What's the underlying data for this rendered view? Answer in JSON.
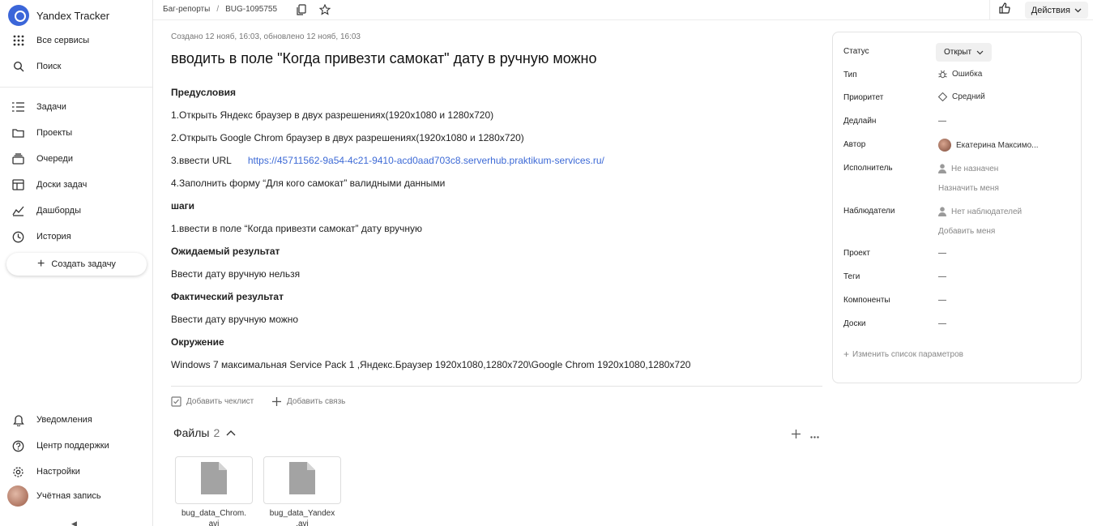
{
  "app": {
    "name": "Yandex Tracker"
  },
  "sidebar": {
    "top_items": [
      {
        "label": "Все сервисы",
        "icon": "grid-icon"
      },
      {
        "label": "Поиск",
        "icon": "search-icon"
      }
    ],
    "nav_items": [
      {
        "label": "Задачи",
        "icon": "tasks-icon"
      },
      {
        "label": "Проекты",
        "icon": "projects-icon"
      },
      {
        "label": "Очереди",
        "icon": "queues-icon"
      },
      {
        "label": "Доски задач",
        "icon": "boards-icon"
      },
      {
        "label": "Дашборды",
        "icon": "dashboards-icon"
      },
      {
        "label": "История",
        "icon": "history-icon"
      }
    ],
    "create_label": "Создать задачу",
    "bottom_items": [
      {
        "label": "Уведомления",
        "icon": "bell-icon"
      },
      {
        "label": "Центр поддержки",
        "icon": "help-icon"
      },
      {
        "label": "Настройки",
        "icon": "gear-icon"
      },
      {
        "label": "Учётная запись",
        "icon": "avatar"
      }
    ]
  },
  "topbar": {
    "breadcrumb_queue": "Баг-репорты",
    "breadcrumb_sep": "/",
    "breadcrumb_issue": "BUG-1095755",
    "actions_label": "Действия"
  },
  "issue": {
    "meta": "Создано 12 нояб, 16:03, обновлено 12 нояб, 16:03",
    "title": "вводить в поле \"Когда привезти самокат\" дату в ручную можно",
    "description": {
      "h_preconditions": "Предусловия",
      "p1": "1.Открыть Яндекс браузер в двух разрешениях(1920х1080 и 1280х720)",
      "p2": "2.Открыть Google Chrom браузер в двух разрешениях(1920х1080 и 1280х720)",
      "p3_prefix": "3.ввести URL",
      "p3_link": "https://45711562-9a54-4c21-9410-acd0aad703c8.serverhub.praktikum-services.ru/",
      "p4": "4.Заполнить форму “Для кого самокат” валидными данными",
      "h_steps": "шаги",
      "s1": "1.ввести в поле “Когда привезти самокат” дату вручную",
      "h_expected": "Ожидаемый результат",
      "expected": "Ввести дату вручную нельзя",
      "h_actual": "Фактический результат",
      "actual": "Ввести дату вручную можно",
      "h_env": "Окружение",
      "env": "Windows 7 максимальная Service Pack 1 ,Яндекс.Браузер 1920х1080,1280х720\\Google Chrom 1920х1080,1280х720"
    },
    "add_checklist": "Добавить чеклист",
    "add_link": "Добавить связь",
    "files": {
      "title": "Файлы",
      "count": "2",
      "items": [
        {
          "name_line1": "bug_data_Chrom.",
          "name_line2": "avi"
        },
        {
          "name_line1": "bug_data_Yandex",
          "name_line2": ".avi"
        }
      ]
    }
  },
  "props": {
    "status": {
      "label": "Статус",
      "value": "Открыт"
    },
    "type": {
      "label": "Тип",
      "value": "Ошибка"
    },
    "priority": {
      "label": "Приоритет",
      "value": "Средний"
    },
    "deadline": {
      "label": "Дедлайн",
      "value": "—"
    },
    "author": {
      "label": "Автор",
      "value": "Екатерина Максимо..."
    },
    "assignee": {
      "label": "Исполнитель",
      "value": "Не назначен",
      "action": "Назначить меня"
    },
    "followers": {
      "label": "Наблюдатели",
      "value": "Нет наблюдателей",
      "action": "Добавить меня"
    },
    "project": {
      "label": "Проект",
      "value": "—"
    },
    "tags": {
      "label": "Теги",
      "value": "—"
    },
    "components": {
      "label": "Компоненты",
      "value": "—"
    },
    "boards": {
      "label": "Доски",
      "value": "—"
    },
    "change_params": "Изменить список параметров"
  }
}
